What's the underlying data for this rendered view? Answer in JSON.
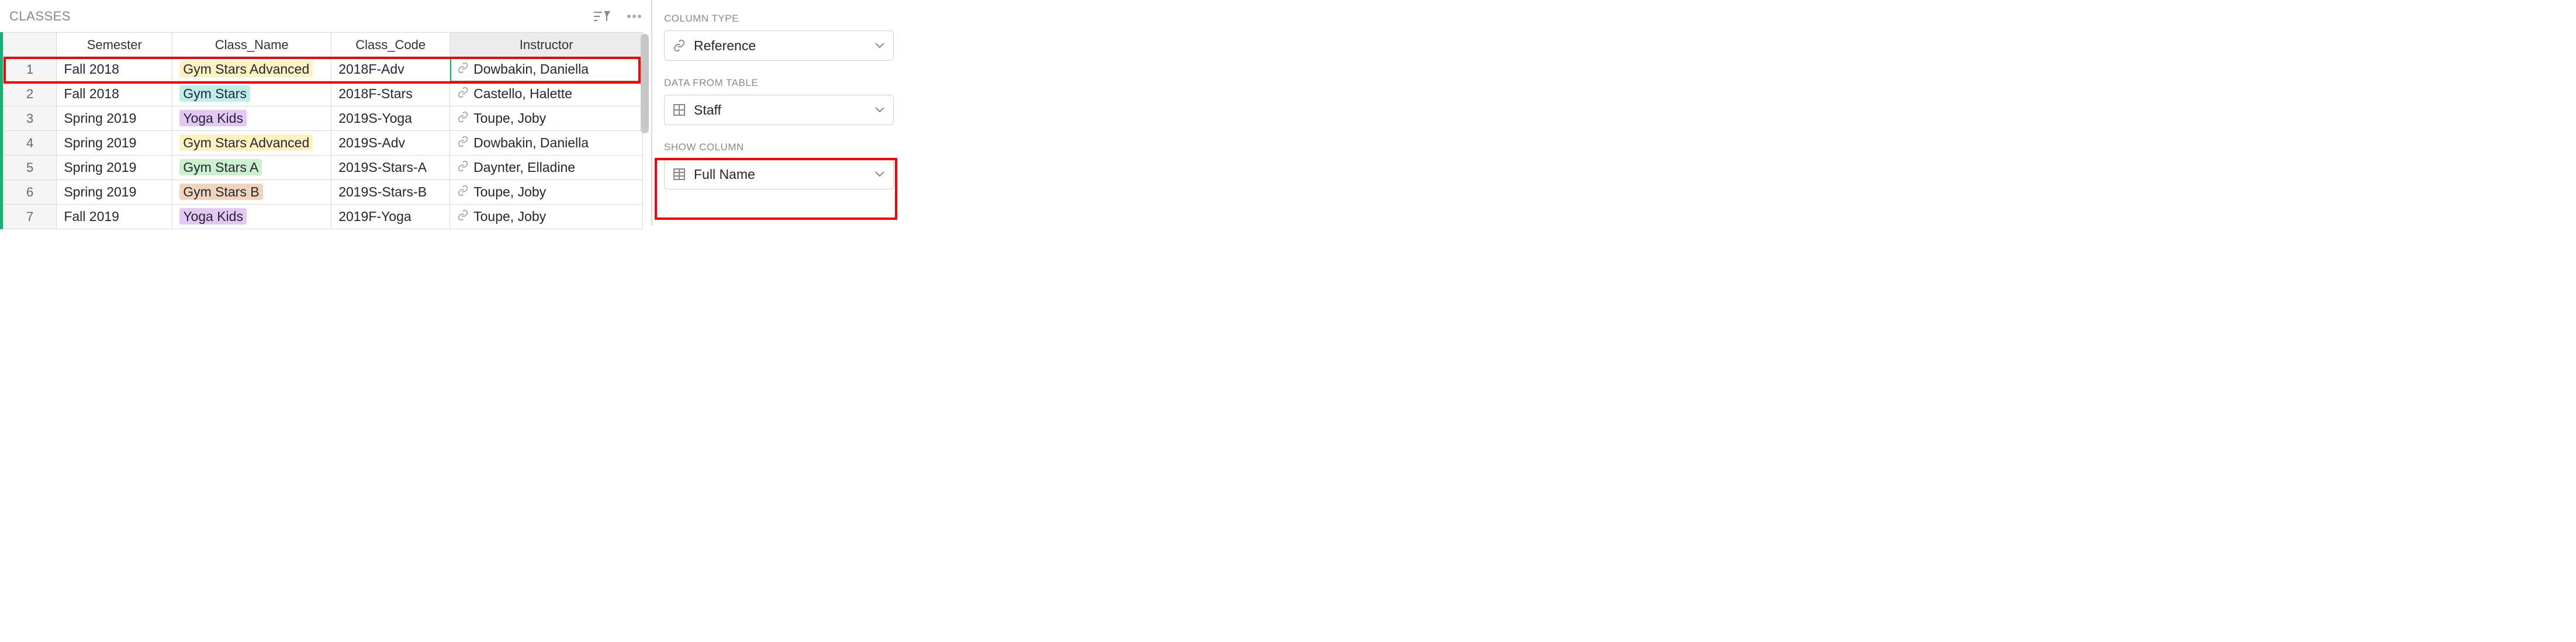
{
  "table": {
    "title": "CLASSES",
    "columns": {
      "semester": "Semester",
      "class_name": "Class_Name",
      "class_code": "Class_Code",
      "instructor": "Instructor"
    },
    "rows": [
      {
        "num": "1",
        "semester": "Fall 2018",
        "class_name": "Gym Stars Advanced",
        "class_pill": "yellow",
        "class_code": "2018F-Adv",
        "instructor": "Dowbakin, Daniella"
      },
      {
        "num": "2",
        "semester": "Fall 2018",
        "class_name": "Gym Stars",
        "class_pill": "cyan",
        "class_code": "2018F-Stars",
        "instructor": "Castello, Halette"
      },
      {
        "num": "3",
        "semester": "Spring 2019",
        "class_name": "Yoga Kids",
        "class_pill": "purple",
        "class_code": "2019S-Yoga",
        "instructor": "Toupe, Joby"
      },
      {
        "num": "4",
        "semester": "Spring 2019",
        "class_name": "Gym Stars Advanced",
        "class_pill": "yellow",
        "class_code": "2019S-Adv",
        "instructor": "Dowbakin, Daniella"
      },
      {
        "num": "5",
        "semester": "Spring 2019",
        "class_name": "Gym Stars A",
        "class_pill": "green",
        "class_code": "2019S-Stars-A",
        "instructor": "Daynter, Elladine"
      },
      {
        "num": "6",
        "semester": "Spring 2019",
        "class_name": "Gym Stars B",
        "class_pill": "tan",
        "class_code": "2019S-Stars-B",
        "instructor": "Toupe, Joby"
      },
      {
        "num": "7",
        "semester": "Fall 2019",
        "class_name": "Yoga Kids",
        "class_pill": "purple",
        "class_code": "2019F-Yoga",
        "instructor": "Toupe, Joby"
      }
    ]
  },
  "right_panel": {
    "column_type": {
      "label": "COLUMN TYPE",
      "value": "Reference"
    },
    "data_from_table": {
      "label": "DATA FROM TABLE",
      "value": "Staff"
    },
    "show_column": {
      "label": "SHOW COLUMN",
      "value": "Full Name"
    }
  }
}
